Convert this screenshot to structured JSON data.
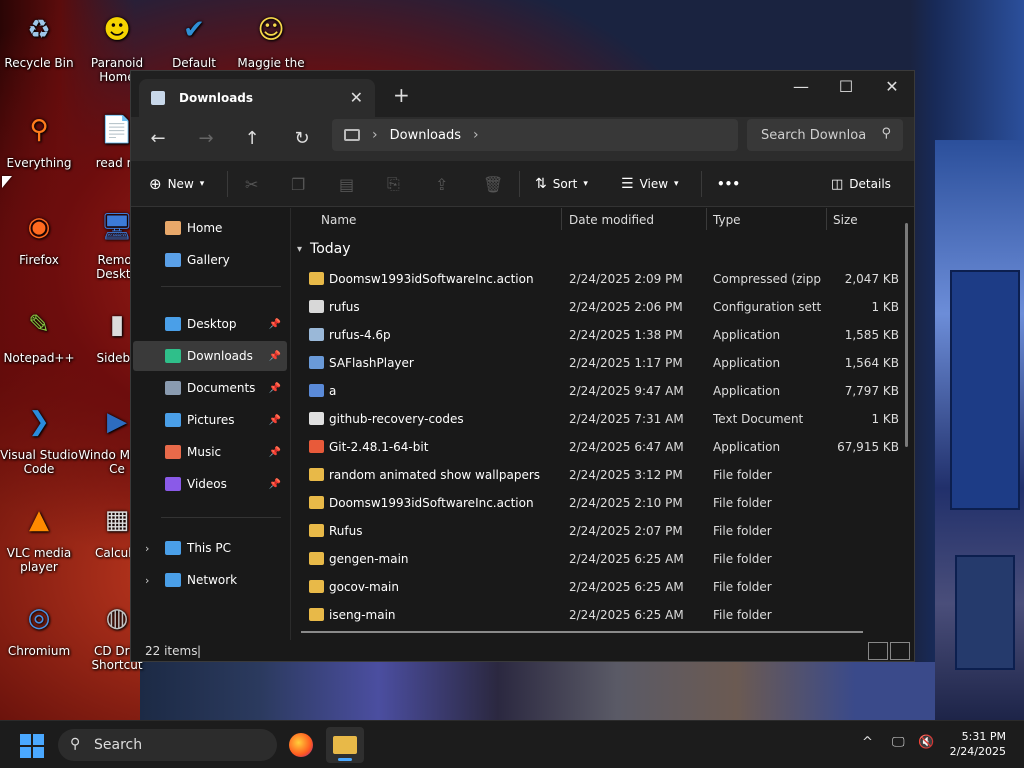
{
  "desktop": {
    "icons": [
      {
        "label": "Recycle Bin",
        "glyph": "♻",
        "color": "#9ec6e8"
      },
      {
        "label": "Paranoid Home",
        "glyph": "☻",
        "color": "#f5d400"
      },
      {
        "label": "Default",
        "glyph": "✔",
        "color": "#2f8fd6"
      },
      {
        "label": "Maggie the",
        "glyph": "☺",
        "color": "#f7d84a"
      },
      {
        "label": "Everything",
        "glyph": "⚲",
        "color": "#ff7b1c"
      },
      {
        "label": "read m",
        "glyph": "📄",
        "color": "#e8e8e8"
      },
      {
        "label": "Firefox",
        "glyph": "◉",
        "color": "#ff6a1f"
      },
      {
        "label": "Remot Deskto",
        "glyph": "🖥",
        "color": "#3c7ad8"
      },
      {
        "label": "Notepad++",
        "glyph": "✎",
        "color": "#86c440"
      },
      {
        "label": "Sideba",
        "glyph": "▮",
        "color": "#dcdcdc"
      },
      {
        "label": "Visual Studio Code",
        "glyph": "❯",
        "color": "#2a8bdc"
      },
      {
        "label": "Windo Media Ce",
        "glyph": "▶",
        "color": "#2d6cc0"
      },
      {
        "label": "VLC media player",
        "glyph": "▲",
        "color": "#ff8a00"
      },
      {
        "label": "Calcula",
        "glyph": "▦",
        "color": "#dcdcdc"
      },
      {
        "label": "Chromium",
        "glyph": "◎",
        "color": "#4a90e2"
      },
      {
        "label": "CD Driv Shortcut",
        "glyph": "◍",
        "color": "#c0c0c0"
      }
    ]
  },
  "window": {
    "tab_title": "Downloads",
    "new_tab": "+",
    "controls": {
      "minimize": "—",
      "maximize": "☐",
      "close": "✕"
    },
    "nav": {
      "back": "←",
      "forward": "→",
      "up": "↑",
      "refresh": "↻"
    },
    "breadcrumb": {
      "location": "Downloads",
      "chev": "›"
    },
    "search_placeholder": "Search Downloa",
    "toolbar": {
      "new_label": "New",
      "sort_label": "Sort",
      "view_label": "View",
      "more_label": "•••",
      "details_label": "Details"
    }
  },
  "navpane": {
    "quick": [
      {
        "label": "Home",
        "color": "#e8a86a"
      },
      {
        "label": "Gallery",
        "color": "#5aa0e8"
      }
    ],
    "pinned": [
      {
        "label": "Desktop",
        "color": "#4a9fe8",
        "selected": false
      },
      {
        "label": "Downloads",
        "color": "#2fbf8a",
        "selected": true
      },
      {
        "label": "Documents",
        "color": "#8a9bb0",
        "selected": false
      },
      {
        "label": "Pictures",
        "color": "#4a9fe8",
        "selected": false
      },
      {
        "label": "Music",
        "color": "#e86a4a",
        "selected": false
      },
      {
        "label": "Videos",
        "color": "#8a5ae8",
        "selected": false
      }
    ],
    "tree": [
      {
        "label": "This PC",
        "color": "#4a9fe8"
      },
      {
        "label": "Network",
        "color": "#4a9fe8"
      }
    ]
  },
  "list": {
    "columns": [
      "Name",
      "Date modified",
      "Type",
      "Size"
    ],
    "group": "Today",
    "rows": [
      {
        "name": "Doomsw1993idSoftwareInc.action",
        "date": "2/24/2025 2:09 PM",
        "type": "Compressed (zipp...",
        "size": "2,047 KB",
        "icon": "zip"
      },
      {
        "name": "rufus",
        "date": "2/24/2025 2:06 PM",
        "type": "Configuration sett...",
        "size": "1 KB",
        "icon": "cfg"
      },
      {
        "name": "rufus-4.6p",
        "date": "2/24/2025 1:38 PM",
        "type": "Application",
        "size": "1,585 KB",
        "icon": "app"
      },
      {
        "name": "SAFlashPlayer",
        "date": "2/24/2025 1:17 PM",
        "type": "Application",
        "size": "1,564 KB",
        "icon": "flash"
      },
      {
        "name": "a",
        "date": "2/24/2025 9:47 AM",
        "type": "Application",
        "size": "7,797 KB",
        "icon": "exe"
      },
      {
        "name": "github-recovery-codes",
        "date": "2/24/2025 7:31 AM",
        "type": "Text Document",
        "size": "1 KB",
        "icon": "txt"
      },
      {
        "name": "Git-2.48.1-64-bit",
        "date": "2/24/2025 6:47 AM",
        "type": "Application",
        "size": "67,915 KB",
        "icon": "git"
      },
      {
        "name": "random animated show wallpapers",
        "date": "2/24/2025 3:12 PM",
        "type": "File folder",
        "size": "",
        "icon": "folder"
      },
      {
        "name": "Doomsw1993idSoftwareInc.action",
        "date": "2/24/2025 2:10 PM",
        "type": "File folder",
        "size": "",
        "icon": "folder"
      },
      {
        "name": "Rufus",
        "date": "2/24/2025 2:07 PM",
        "type": "File folder",
        "size": "",
        "icon": "folder"
      },
      {
        "name": "gengen-main",
        "date": "2/24/2025 6:25 AM",
        "type": "File folder",
        "size": "",
        "icon": "folder"
      },
      {
        "name": "gocov-main",
        "date": "2/24/2025 6:25 AM",
        "type": "File folder",
        "size": "",
        "icon": "folder"
      },
      {
        "name": "iseng-main",
        "date": "2/24/2025 6:25 AM",
        "type": "File folder",
        "size": "",
        "icon": "folder"
      }
    ]
  },
  "status": {
    "items": "22 items",
    "sep": "|"
  },
  "taskbar": {
    "search_label": "Search",
    "time": "5:31 PM",
    "date": "2/24/2025"
  },
  "colors": {
    "folder": "#e8b948",
    "zip": "#e8b948",
    "cfg": "#d8d8d8",
    "app": "#9ab8d8",
    "flash": "#6a9ad8",
    "exe": "#5a8ad8",
    "txt": "#e0e0e0",
    "git": "#e85a3a",
    "accent": "#4aa8ff"
  }
}
